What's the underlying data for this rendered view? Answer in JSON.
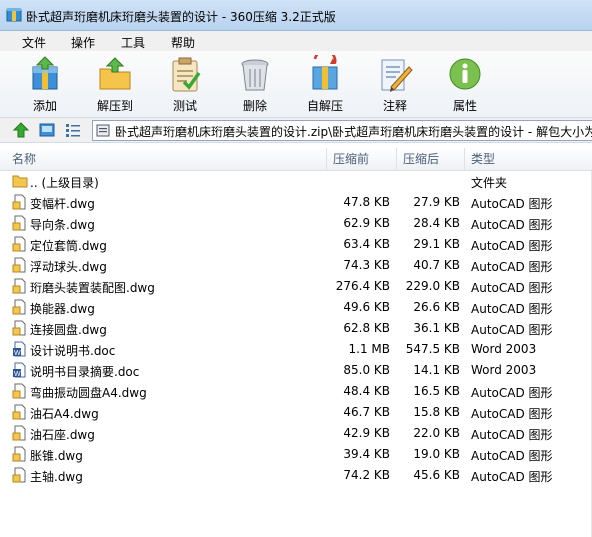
{
  "window": {
    "title": "卧式超声珩磨机床珩磨头装置的设计 - 360压缩 3.2正式版",
    "icon": "archive-app-icon"
  },
  "menu": [
    "文件",
    "操作",
    "工具",
    "帮助"
  ],
  "toolbar": [
    {
      "label": "添加",
      "icon": "add-archive-icon"
    },
    {
      "label": "解压到",
      "icon": "extract-folder-icon"
    },
    {
      "label": "测试",
      "icon": "test-clipboard-icon"
    },
    {
      "label": "删除",
      "icon": "trash-bin-icon"
    },
    {
      "label": "自解压",
      "icon": "self-extract-icon"
    },
    {
      "label": "注释",
      "icon": "comment-pencil-icon"
    },
    {
      "label": "属性",
      "icon": "info-icon"
    }
  ],
  "address": {
    "path": "卧式超声珩磨机床珩磨头装置的设计.zip\\卧式超声珩磨机床珩磨头装置的设计 - 解包大小为"
  },
  "columns": {
    "name": "名称",
    "size": "压缩前",
    "packed": "压缩后",
    "type": "类型"
  },
  "files": [
    {
      "name": ".. (上级目录)",
      "size": "",
      "packed": "",
      "type": "文件夹",
      "icon": "folder"
    },
    {
      "name": "变幅杆.dwg",
      "size": "47.8 KB",
      "packed": "27.9 KB",
      "type": "AutoCAD 图形",
      "icon": "dwg"
    },
    {
      "name": "导向条.dwg",
      "size": "62.9 KB",
      "packed": "28.4 KB",
      "type": "AutoCAD 图形",
      "icon": "dwg"
    },
    {
      "name": "定位套筒.dwg",
      "size": "63.4 KB",
      "packed": "29.1 KB",
      "type": "AutoCAD 图形",
      "icon": "dwg"
    },
    {
      "name": "浮动球头.dwg",
      "size": "74.3 KB",
      "packed": "40.7 KB",
      "type": "AutoCAD 图形",
      "icon": "dwg"
    },
    {
      "name": "珩磨头装置装配图.dwg",
      "size": "276.4 KB",
      "packed": "229.0 KB",
      "type": "AutoCAD 图形",
      "icon": "dwg"
    },
    {
      "name": "换能器.dwg",
      "size": "49.6 KB",
      "packed": "26.6 KB",
      "type": "AutoCAD 图形",
      "icon": "dwg"
    },
    {
      "name": "连接圆盘.dwg",
      "size": "62.8 KB",
      "packed": "36.1 KB",
      "type": "AutoCAD 图形",
      "icon": "dwg"
    },
    {
      "name": "设计说明书.doc",
      "size": "1.1 MB",
      "packed": "547.5 KB",
      "type": "Word 2003",
      "icon": "doc"
    },
    {
      "name": "说明书目录摘要.doc",
      "size": "85.0 KB",
      "packed": "14.1 KB",
      "type": "Word 2003",
      "icon": "doc"
    },
    {
      "name": "弯曲振动圆盘A4.dwg",
      "size": "48.4 KB",
      "packed": "16.5 KB",
      "type": "AutoCAD 图形",
      "icon": "dwg"
    },
    {
      "name": "油石A4.dwg",
      "size": "46.7 KB",
      "packed": "15.8 KB",
      "type": "AutoCAD 图形",
      "icon": "dwg"
    },
    {
      "name": "油石座.dwg",
      "size": "42.9 KB",
      "packed": "22.0 KB",
      "type": "AutoCAD 图形",
      "icon": "dwg"
    },
    {
      "name": "胀锥.dwg",
      "size": "39.4 KB",
      "packed": "19.0 KB",
      "type": "AutoCAD 图形",
      "icon": "dwg"
    },
    {
      "name": "主轴.dwg",
      "size": "74.2 KB",
      "packed": "45.6 KB",
      "type": "AutoCAD 图形",
      "icon": "dwg"
    }
  ]
}
